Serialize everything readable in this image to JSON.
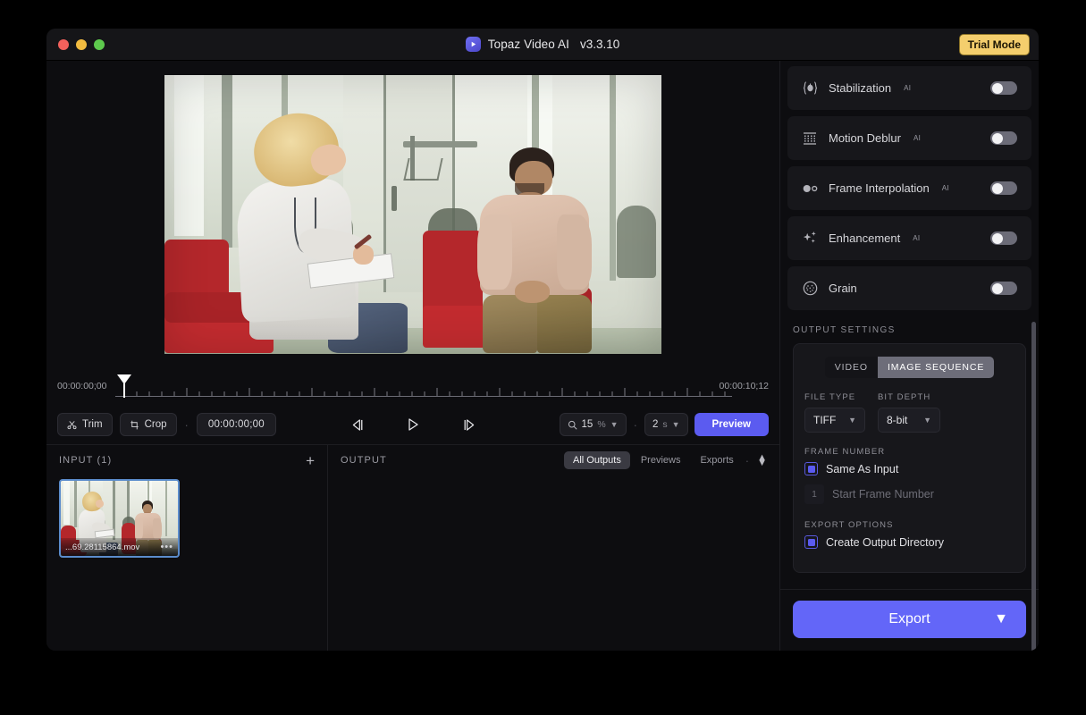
{
  "titlebar": {
    "app_name": "Topaz Video AI",
    "version": "v3.3.10",
    "trial_badge": "Trial Mode"
  },
  "timeline": {
    "start_timecode": "00:00:00;00",
    "end_timecode": "00:00:10;12"
  },
  "controls": {
    "trim_label": "Trim",
    "crop_label": "Crop",
    "current_timecode": "00:00:00;00",
    "zoom_value": "15",
    "zoom_unit": "%",
    "duration_value": "2",
    "duration_unit": "s",
    "preview_label": "Preview"
  },
  "input_panel": {
    "title": "INPUT (1)",
    "add_label": "+",
    "file_name": "...69.28115864.mov"
  },
  "output_panel": {
    "title": "OUTPUT",
    "tabs": [
      {
        "label": "All Outputs",
        "active": true
      },
      {
        "label": "Previews",
        "active": false
      },
      {
        "label": "Exports",
        "active": false
      }
    ]
  },
  "filters": [
    {
      "name": "Stabilization",
      "sup": "AI",
      "icon": "stabilization-icon",
      "enabled": false
    },
    {
      "name": "Motion Deblur",
      "sup": "AI",
      "icon": "motion-deblur-icon",
      "enabled": false
    },
    {
      "name": "Frame Interpolation",
      "sup": "AI",
      "icon": "frame-interpolation-icon",
      "enabled": false
    },
    {
      "name": "Enhancement",
      "sup": "AI",
      "icon": "enhancement-icon",
      "enabled": false
    },
    {
      "name": "Grain",
      "sup": "",
      "icon": "grain-icon",
      "enabled": false
    }
  ],
  "output_settings": {
    "section_title": "OUTPUT SETTINGS",
    "mode_video": "VIDEO",
    "mode_image_sequence": "IMAGE SEQUENCE",
    "file_type_label": "FILE TYPE",
    "file_type_value": "TIFF",
    "bit_depth_label": "BIT DEPTH",
    "bit_depth_value": "8-bit",
    "frame_number_label": "FRAME NUMBER",
    "same_as_input_label": "Same As Input",
    "start_frame_value": "1",
    "start_frame_placeholder": "Start Frame Number",
    "export_options_label": "EXPORT OPTIONS",
    "create_output_directory_label": "Create Output Directory"
  },
  "export": {
    "label": "Export"
  },
  "colors": {
    "accent_purple": "#6366f8",
    "preview_purple": "#5b5bf0",
    "trial_yellow": "#f4ce6d",
    "selection_blue": "#5b8ccc"
  }
}
